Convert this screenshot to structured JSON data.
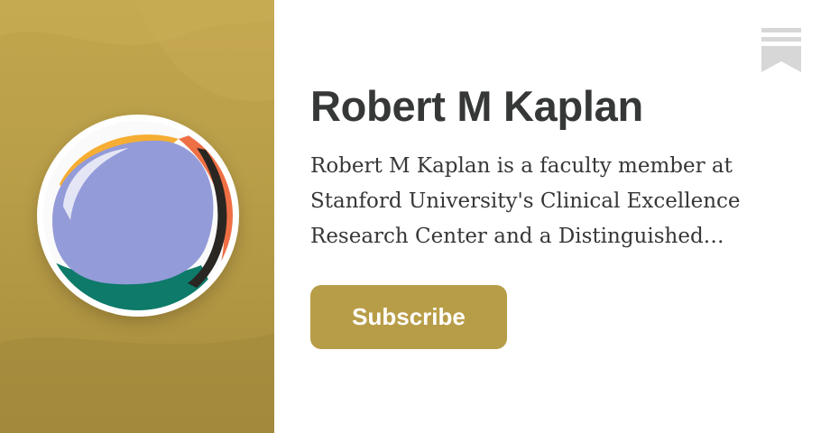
{
  "publication": {
    "title": "Robert M Kaplan",
    "description_lines": [
      "Robert M Kaplan is a faculty member at",
      "Stanford University's Clinical Excellence",
      "Research Center and a Distinguished…"
    ]
  },
  "actions": {
    "subscribe_label": "Subscribe"
  },
  "icons": {
    "bookmark": "bookmark-icon",
    "logo": "publication-logo"
  },
  "colors": {
    "brand": "#b89d48",
    "panel": "#c2a64d",
    "text": "#363737",
    "logo_lavender": "#939bd8",
    "logo_orange": "#f59a3a",
    "logo_teal": "#0e7a6a",
    "logo_coral": "#ef6f45"
  }
}
